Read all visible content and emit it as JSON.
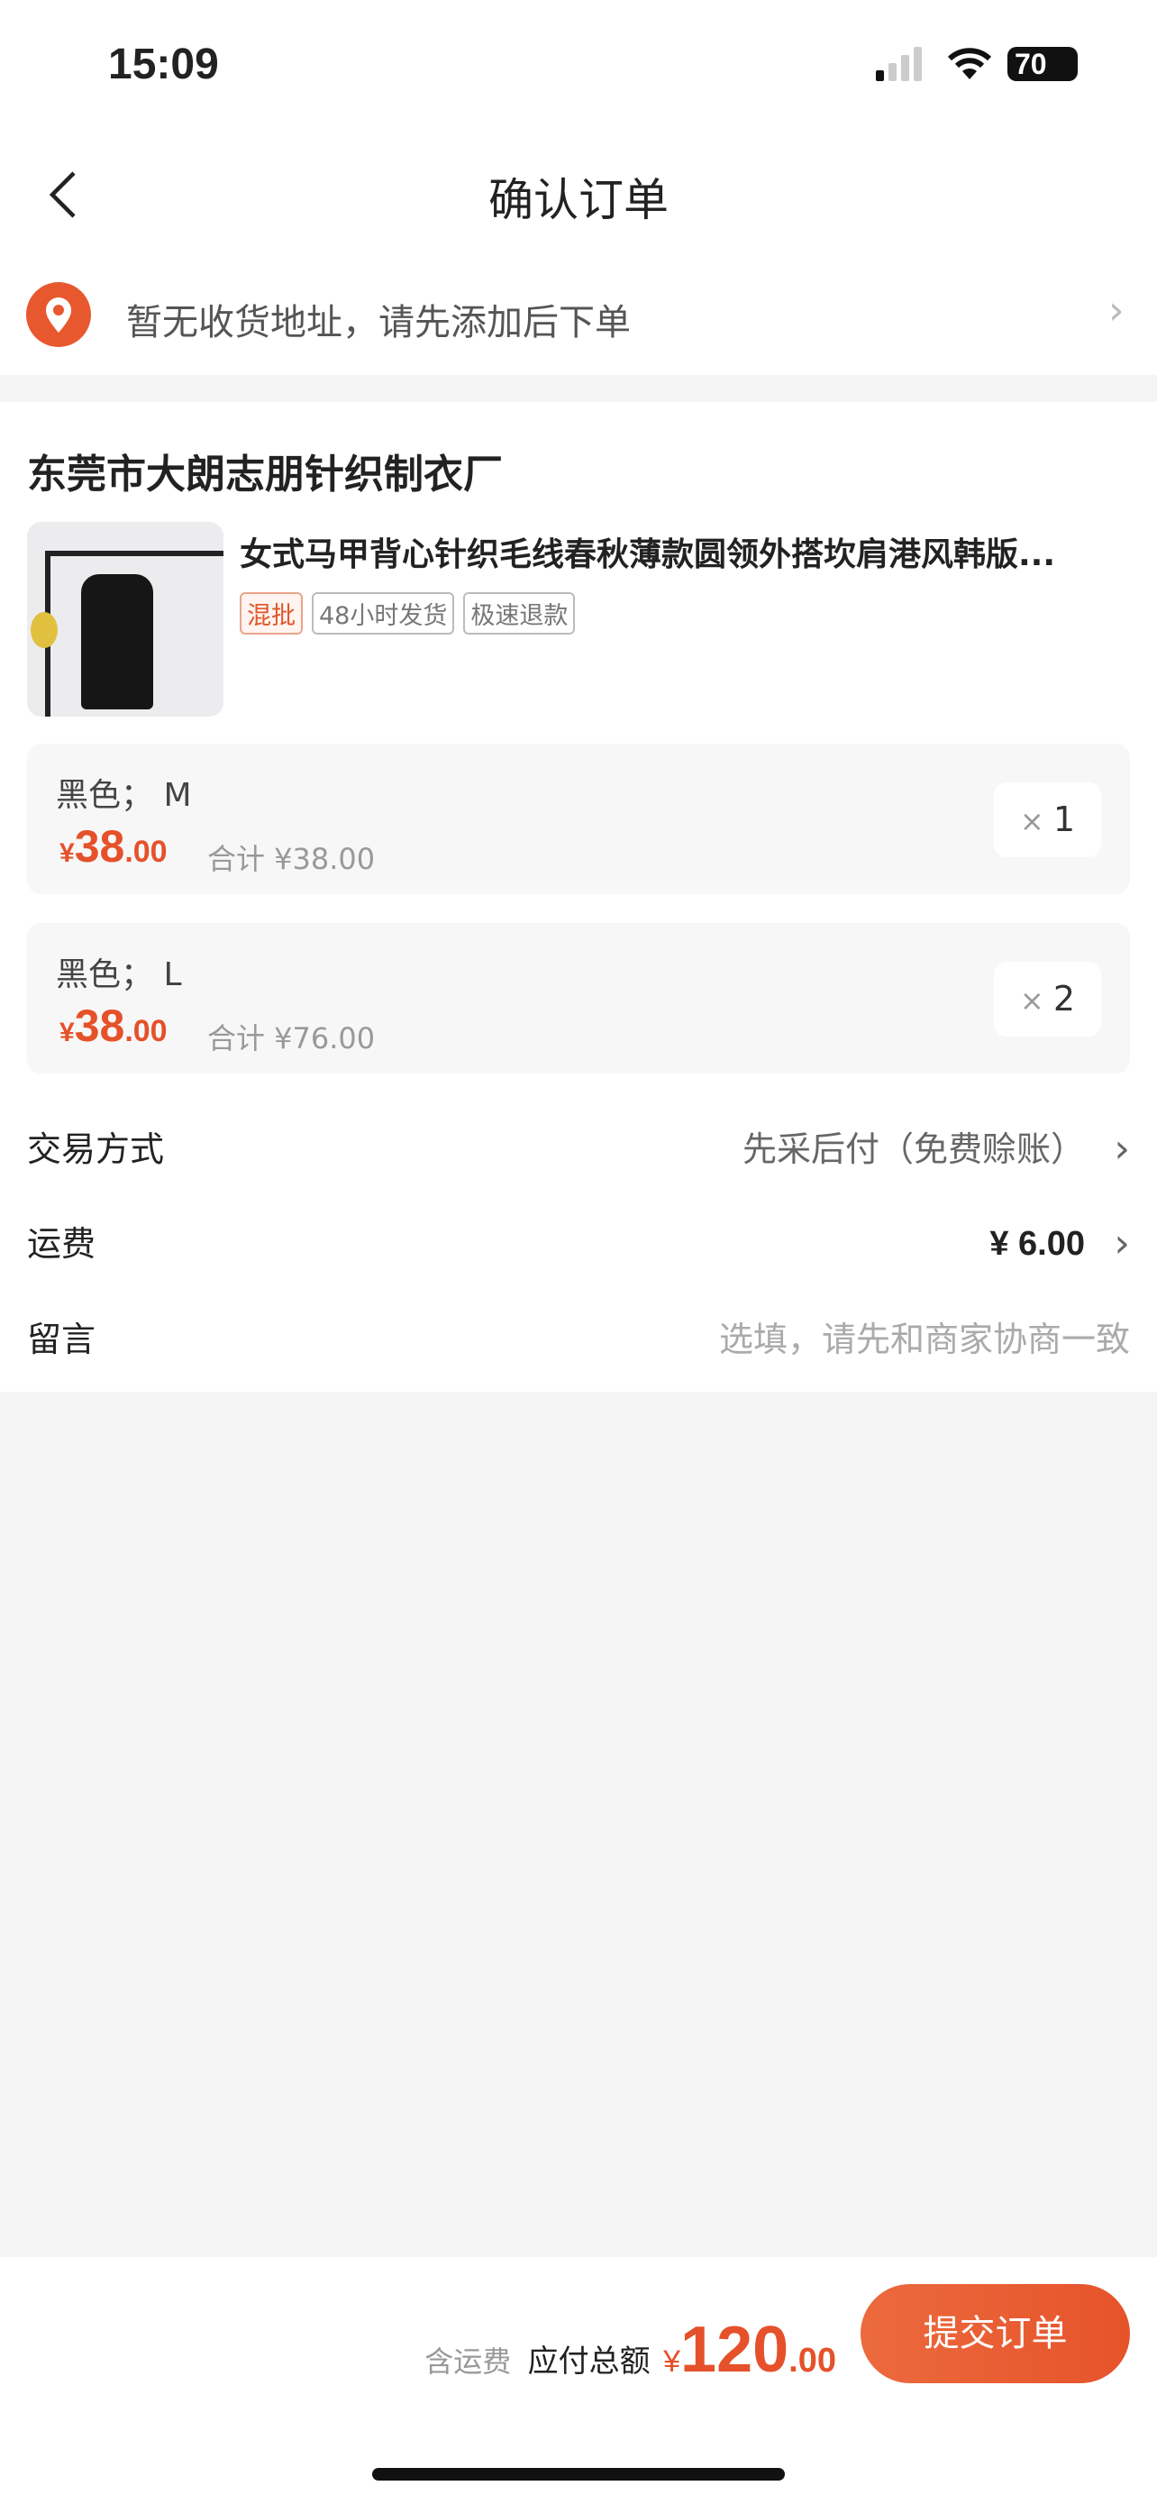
{
  "status_bar": {
    "time": "15:09",
    "battery": "70"
  },
  "nav": {
    "title": "确认订单"
  },
  "address": {
    "placeholder": "暂无收货地址，请先添加后下单"
  },
  "shop": {
    "name": "东莞市大朗志朋针织制衣厂"
  },
  "product": {
    "title": "女式马甲背心针织毛线春秋薄款圆领外搭坎肩港风韩版...",
    "tags": [
      "混批",
      "48小时发货",
      "极速退款"
    ]
  },
  "skus": [
    {
      "spec": "黑色； M",
      "currency": "¥",
      "price_int": "38",
      "price_dec": ".00",
      "subtotal": "合计 ¥38.00",
      "qty": "1"
    },
    {
      "spec": "黑色； L",
      "currency": "¥",
      "price_int": "38",
      "price_dec": ".00",
      "subtotal": "合计 ¥76.00",
      "qty": "2"
    }
  ],
  "rows": {
    "trade_label": "交易方式",
    "trade_value": "先采后付（免费赊账）",
    "shipping_label": "运费",
    "shipping_value": "¥ 6.00",
    "message_label": "留言",
    "message_placeholder": "选填，请先和商家协商一致"
  },
  "footer": {
    "incl_shipping": "含运费",
    "total_label": "应付总额",
    "currency": "¥",
    "total_int": "120",
    "total_dec": ".00",
    "submit": "提交订单"
  },
  "colors": {
    "accent": "#e5512a"
  }
}
